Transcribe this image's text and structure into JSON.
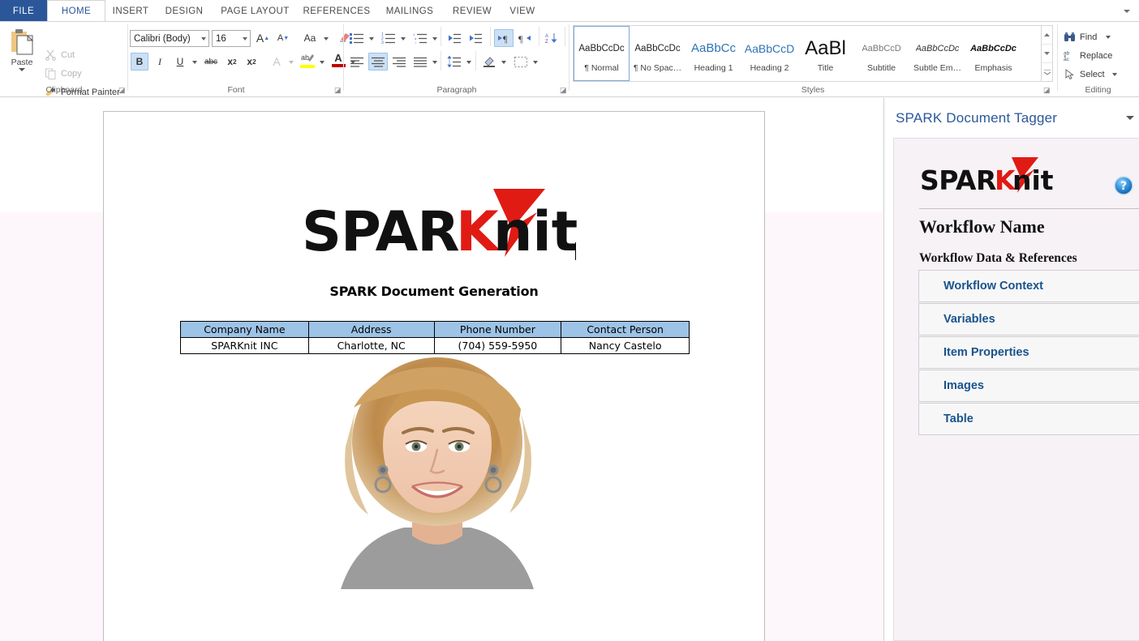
{
  "window": {
    "accent_color": "#C0101B",
    "ribbon_collapse_icon": "chevron-down-icon"
  },
  "tabs": [
    {
      "label": "FILE",
      "active": false,
      "file": true
    },
    {
      "label": "HOME",
      "active": true
    },
    {
      "label": "INSERT",
      "active": false
    },
    {
      "label": "DESIGN",
      "active": false
    },
    {
      "label": "PAGE LAYOUT",
      "active": false
    },
    {
      "label": "REFERENCES",
      "active": false
    },
    {
      "label": "MAILINGS",
      "active": false
    },
    {
      "label": "REVIEW",
      "active": false
    },
    {
      "label": "VIEW",
      "active": false
    }
  ],
  "ribbon": {
    "clipboard": {
      "group_label": "Clipboard",
      "paste_label": "Paste",
      "commands": [
        {
          "label": "Cut",
          "icon": "scissors-icon",
          "enabled": false
        },
        {
          "label": "Copy",
          "icon": "copy-icon",
          "enabled": false
        },
        {
          "label": "Format Painter",
          "icon": "paintbrush-icon",
          "enabled": true
        }
      ]
    },
    "font": {
      "group_label": "Font",
      "font_family_value": "Calibri (Body)",
      "font_size_value": "16",
      "buttons": [
        {
          "name": "grow-font",
          "glyph": "A"
        },
        {
          "name": "shrink-font",
          "glyph": "A"
        },
        {
          "name": "change-case",
          "glyph": "Aa"
        },
        {
          "name": "clear-formatting",
          "glyph": "eraser-icon"
        },
        {
          "name": "bold",
          "glyph": "B",
          "selected": true
        },
        {
          "name": "italic",
          "glyph": "I"
        },
        {
          "name": "underline",
          "glyph": "U"
        },
        {
          "name": "strikethrough",
          "glyph": "abc"
        },
        {
          "name": "subscript",
          "glyph": "x₂"
        },
        {
          "name": "superscript",
          "glyph": "x²"
        },
        {
          "name": "text-effects",
          "glyph": "A"
        },
        {
          "name": "text-highlight-color",
          "glyph": "ab"
        },
        {
          "name": "font-color",
          "glyph": "A"
        }
      ]
    },
    "paragraph": {
      "group_label": "Paragraph",
      "buttons": [
        {
          "name": "bullets"
        },
        {
          "name": "numbering"
        },
        {
          "name": "multilevel-list"
        },
        {
          "name": "decrease-indent"
        },
        {
          "name": "increase-indent"
        },
        {
          "name": "ltr-text-direction",
          "selected": true
        },
        {
          "name": "rtl-text-direction"
        },
        {
          "name": "sort"
        },
        {
          "name": "show-formatting-marks"
        },
        {
          "name": "align-left"
        },
        {
          "name": "align-center",
          "selected": true
        },
        {
          "name": "align-right"
        },
        {
          "name": "justify"
        },
        {
          "name": "line-spacing"
        },
        {
          "name": "shading"
        },
        {
          "name": "borders"
        }
      ]
    },
    "styles": {
      "group_label": "Styles",
      "items": [
        {
          "preview": "AaBbCcDc",
          "name": "¶ Normal",
          "selected": true,
          "color": "#222",
          "italic": false,
          "bold": false,
          "size": 11.5
        },
        {
          "preview": "AaBbCcDc",
          "name": "¶ No Spac…",
          "selected": false,
          "color": "#222",
          "italic": false,
          "bold": false,
          "size": 11.5
        },
        {
          "preview": "AaBbCc",
          "name": "Heading 1",
          "selected": false,
          "color": "#2E74B5",
          "italic": false,
          "bold": false,
          "size": 15
        },
        {
          "preview": "AaBbCcD",
          "name": "Heading 2",
          "selected": false,
          "color": "#2E74B5",
          "italic": false,
          "bold": false,
          "size": 14
        },
        {
          "preview": "AaBl",
          "name": "Title",
          "selected": false,
          "color": "#111",
          "italic": false,
          "bold": false,
          "size": 24
        },
        {
          "preview": "AaBbCcD",
          "name": "Subtitle",
          "selected": false,
          "color": "#777",
          "italic": false,
          "bold": false,
          "size": 11
        },
        {
          "preview": "AaBbCcDc",
          "name": "Subtle Em…",
          "selected": false,
          "color": "#333",
          "italic": true,
          "bold": false,
          "size": 11
        },
        {
          "preview": "AaBbCcDc",
          "name": "Emphasis",
          "selected": false,
          "color": "#111",
          "italic": true,
          "bold": true,
          "size": 11
        }
      ]
    },
    "editing": {
      "group_label": "Editing",
      "commands": [
        {
          "label": "Find",
          "icon": "binoculars-icon",
          "has_caret": true
        },
        {
          "label": "Replace",
          "icon": "replace-icon",
          "has_caret": false
        },
        {
          "label": "Select",
          "icon": "cursor-arrow-icon",
          "has_caret": true
        }
      ]
    }
  },
  "document": {
    "logo_text_dark": "SPAR",
    "logo_text_k": "K",
    "logo_text_nit": "nit",
    "title": "SPARK Document Generation",
    "table": {
      "headers": [
        "Company Name",
        "Address",
        "Phone Number",
        "Contact Person"
      ],
      "header_fill": "#9DC3E6",
      "rows": [
        [
          "SPARKnit INC",
          "Charlotte, NC",
          "(704) 559-5950",
          "Nancy Castelo"
        ]
      ]
    },
    "photo_alt": "portrait-photo-woman-smiling"
  },
  "task_pane": {
    "title": "SPARK Document Tagger",
    "collapse_icon": "chevron-down-icon",
    "help_icon": "help-question-icon",
    "addin_logo": {
      "text_dark": "SPAR",
      "text_k": "K",
      "text_nit": "nit"
    },
    "workflow_name_heading": "Workflow Name",
    "section_heading": "Workflow Data & References",
    "accordion_items": [
      {
        "label": "Workflow Context"
      },
      {
        "label": "Variables"
      },
      {
        "label": "Item Properties"
      },
      {
        "label": "Images"
      },
      {
        "label": "Table"
      }
    ],
    "link_color": "#18538C"
  }
}
